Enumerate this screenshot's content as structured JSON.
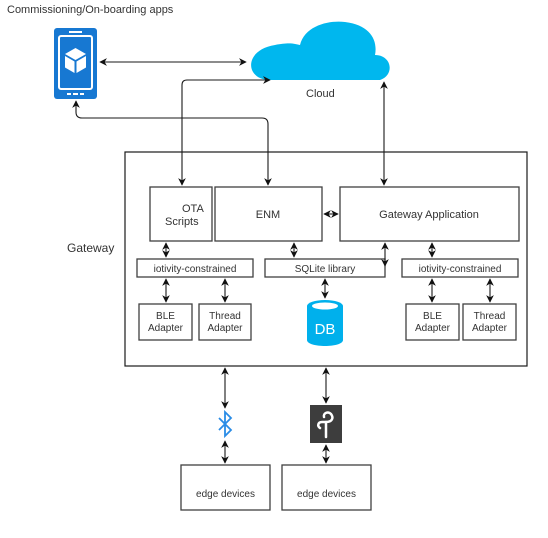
{
  "title_label": "Commissioning/On-boarding apps",
  "cloud": {
    "label": "Cloud",
    "color": "#00B7EE"
  },
  "phone": {
    "color": "#1778D2",
    "icon": "tablet-app-icon"
  },
  "gateway": {
    "label": "Gateway",
    "components": {
      "ota_line1": "OTA",
      "ota_line2": "Scripts",
      "enm": "ENM",
      "gateway_app": "Gateway Application",
      "iotivity_left": "iotivity-constrained",
      "sqlite": "SQLite library",
      "iotivity_right": "iotivity-constrained",
      "ble_left_line1": "BLE",
      "ble_left_line2": "Adapter",
      "thread_left_line1": "Thread",
      "thread_left_line2": "Adapter",
      "ble_right_line1": "BLE",
      "ble_right_line2": "Adapter",
      "thread_right_line1": "Thread",
      "thread_right_line2": "Adapter",
      "db": "DB"
    },
    "db_color": "#00B0EC"
  },
  "edge": {
    "left": "edge devices",
    "right": "edge devices",
    "bluetooth_icon": "bluetooth-icon",
    "thread_icon": "thread-icon",
    "bluetooth_color": "#2A8CE6",
    "thread_bg_color": "#3D3D3D"
  }
}
